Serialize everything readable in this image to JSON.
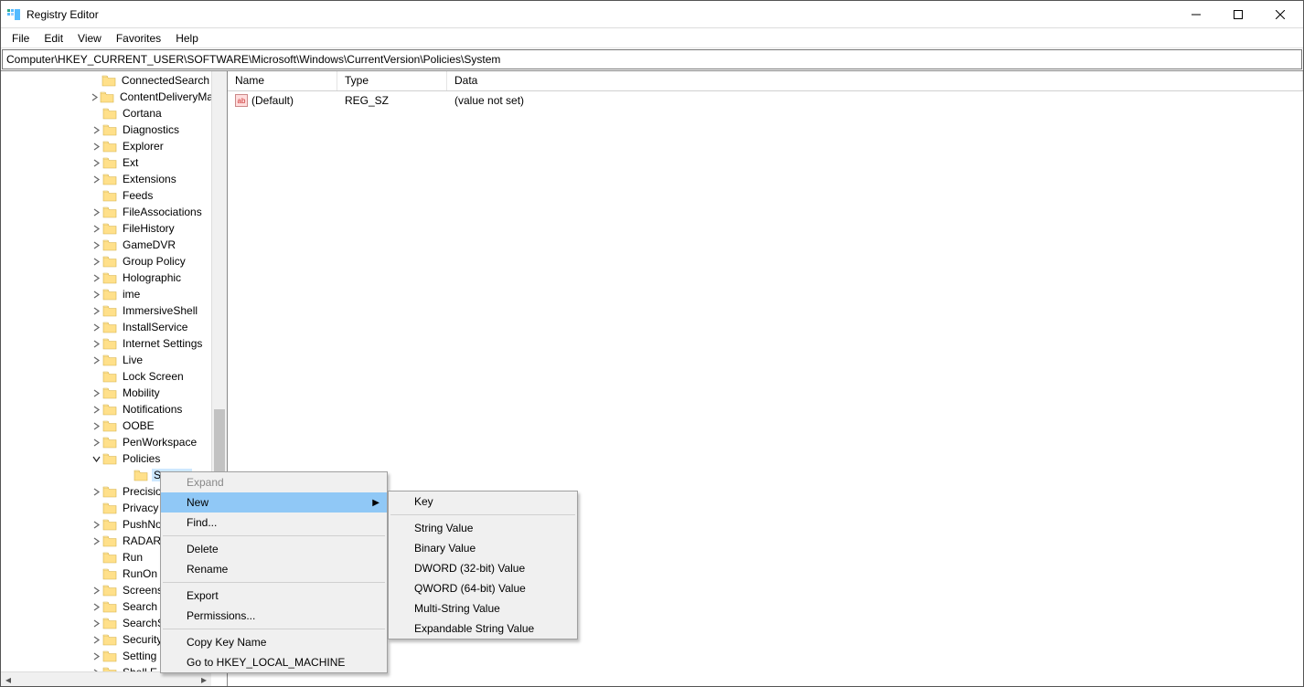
{
  "window": {
    "title": "Registry Editor"
  },
  "menubar": [
    "File",
    "Edit",
    "View",
    "Favorites",
    "Help"
  ],
  "address": "Computer\\HKEY_CURRENT_USER\\SOFTWARE\\Microsoft\\Windows\\CurrentVersion\\Policies\\System",
  "tree": {
    "indent_base": 98,
    "child_indent": 118,
    "grandchild_indent": 132,
    "nodes": [
      {
        "label": "ConnectedSearch",
        "expand": false,
        "level": 0
      },
      {
        "label": "ContentDeliveryMa",
        "expand": true,
        "level": 0
      },
      {
        "label": "Cortana",
        "expand": false,
        "level": 0
      },
      {
        "label": "Diagnostics",
        "expand": true,
        "level": 0
      },
      {
        "label": "Explorer",
        "expand": true,
        "level": 0
      },
      {
        "label": "Ext",
        "expand": true,
        "level": 0
      },
      {
        "label": "Extensions",
        "expand": true,
        "level": 0
      },
      {
        "label": "Feeds",
        "expand": false,
        "level": 0
      },
      {
        "label": "FileAssociations",
        "expand": true,
        "level": 0
      },
      {
        "label": "FileHistory",
        "expand": true,
        "level": 0
      },
      {
        "label": "GameDVR",
        "expand": true,
        "level": 0
      },
      {
        "label": "Group Policy",
        "expand": true,
        "level": 0
      },
      {
        "label": "Holographic",
        "expand": true,
        "level": 0
      },
      {
        "label": "ime",
        "expand": true,
        "level": 0
      },
      {
        "label": "ImmersiveShell",
        "expand": true,
        "level": 0
      },
      {
        "label": "InstallService",
        "expand": true,
        "level": 0
      },
      {
        "label": "Internet Settings",
        "expand": true,
        "level": 0
      },
      {
        "label": "Live",
        "expand": true,
        "level": 0
      },
      {
        "label": "Lock Screen",
        "expand": false,
        "level": 0
      },
      {
        "label": "Mobility",
        "expand": true,
        "level": 0
      },
      {
        "label": "Notifications",
        "expand": true,
        "level": 0
      },
      {
        "label": "OOBE",
        "expand": true,
        "level": 0
      },
      {
        "label": "PenWorkspace",
        "expand": true,
        "level": 0
      },
      {
        "label": "Policies",
        "expand": true,
        "level": 0,
        "expanded": true
      },
      {
        "label": "System",
        "expand": false,
        "level": 1,
        "selected": true
      },
      {
        "label": "Precisio",
        "expand": true,
        "level": 0
      },
      {
        "label": "Privacy",
        "expand": false,
        "level": 0
      },
      {
        "label": "PushNo",
        "expand": true,
        "level": 0
      },
      {
        "label": "RADAR",
        "expand": true,
        "level": 0
      },
      {
        "label": "Run",
        "expand": false,
        "level": 0
      },
      {
        "label": "RunOn",
        "expand": false,
        "level": 0
      },
      {
        "label": "Screens",
        "expand": true,
        "level": 0
      },
      {
        "label": "Search",
        "expand": true,
        "level": 0
      },
      {
        "label": "SearchS",
        "expand": true,
        "level": 0
      },
      {
        "label": "Security",
        "expand": true,
        "level": 0
      },
      {
        "label": "Setting",
        "expand": true,
        "level": 0
      },
      {
        "label": "Shell E",
        "expand": true,
        "level": 0
      }
    ]
  },
  "columns": {
    "name": "Name",
    "type": "Type",
    "data": "Data"
  },
  "values": [
    {
      "name": "(Default)",
      "type": "REG_SZ",
      "data": "(value not set)",
      "icon": "ab"
    }
  ],
  "context_menu": {
    "items": [
      {
        "label": "Expand",
        "disabled": true
      },
      {
        "label": "New",
        "submenu": true,
        "hover": true
      },
      {
        "label": "Find...",
        "sep_after": true
      },
      {
        "label": "Delete"
      },
      {
        "label": "Rename",
        "sep_after": true
      },
      {
        "label": "Export"
      },
      {
        "label": "Permissions...",
        "sep_after": true
      },
      {
        "label": "Copy Key Name"
      },
      {
        "label": "Go to HKEY_LOCAL_MACHINE"
      }
    ]
  },
  "submenu": {
    "items": [
      {
        "label": "Key",
        "sep_after": true
      },
      {
        "label": "String Value"
      },
      {
        "label": "Binary Value"
      },
      {
        "label": "DWORD (32-bit) Value"
      },
      {
        "label": "QWORD (64-bit) Value"
      },
      {
        "label": "Multi-String Value"
      },
      {
        "label": "Expandable String Value"
      }
    ]
  }
}
